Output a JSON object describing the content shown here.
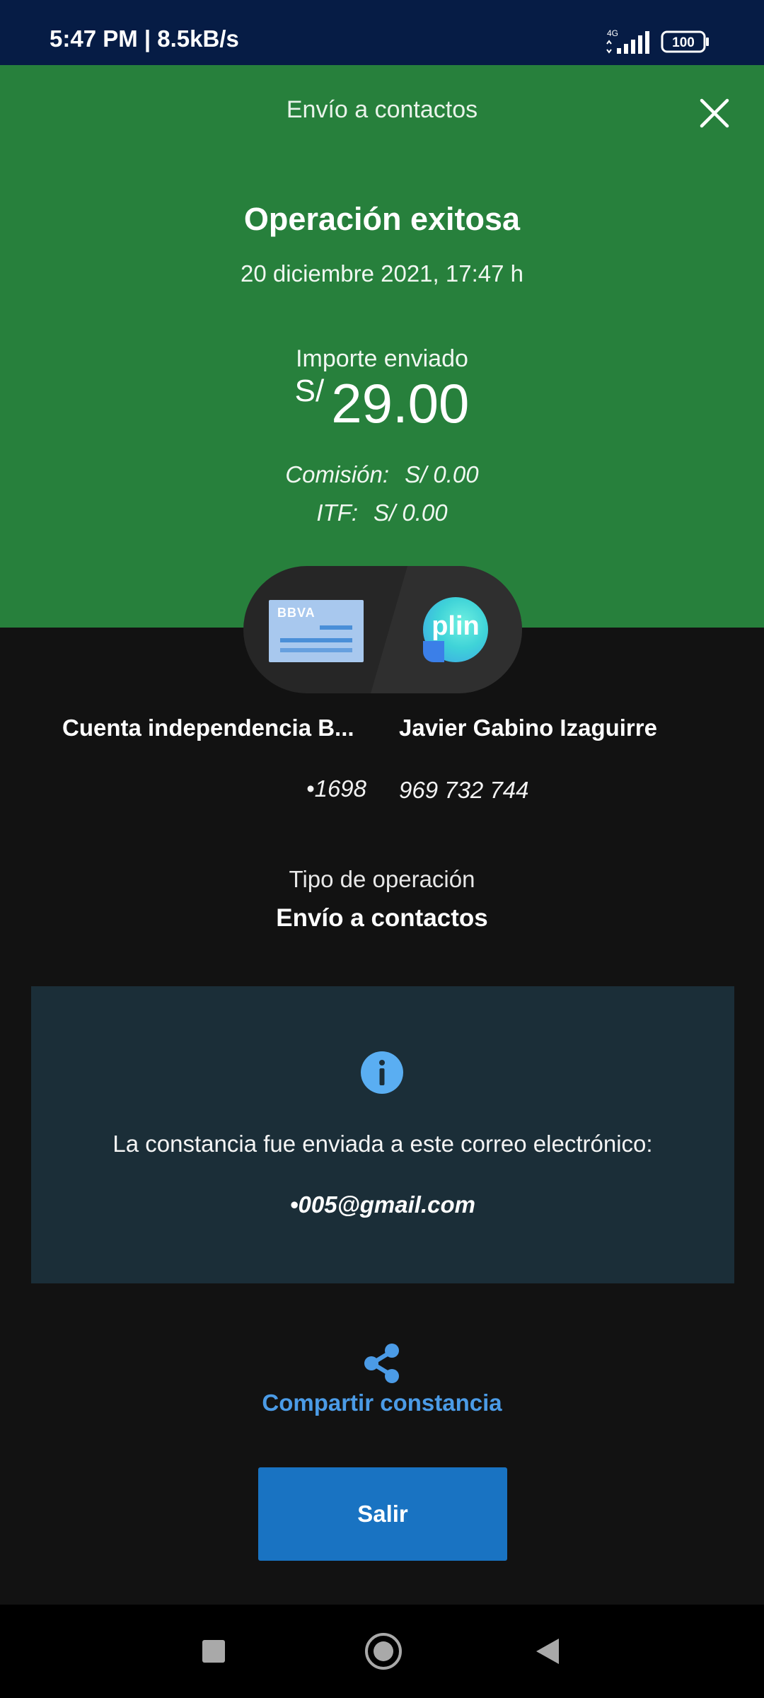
{
  "status_bar": {
    "time_speed": "5:47 PM | 8.5kB/s",
    "network": "4G",
    "battery": "100"
  },
  "header": {
    "title": "Envío a contactos",
    "close_icon": "close-icon"
  },
  "result": {
    "title": "Operación exitosa",
    "date": "20 diciembre 2021, 17:47 h",
    "amount_label": "Importe enviado",
    "currency": "S/",
    "amount": "29.00",
    "commission_label": "Comisión:",
    "commission_value": "S/ 0.00",
    "itf_label": "ITF:",
    "itf_value": "S/ 0.00"
  },
  "transfer": {
    "from_logo_text": "BBVA",
    "to_logo_text": "plin",
    "from_name": "Cuenta independencia B...",
    "from_number": "•1698",
    "to_name": "Javier Gabino Izaguirre",
    "to_number": "969 732 744"
  },
  "operation": {
    "label": "Tipo de operación",
    "value": "Envío a contactos"
  },
  "info": {
    "icon": "info-icon",
    "text": "La constancia fue enviada a este correo electrónico:",
    "email": "•005@gmail.com"
  },
  "share": {
    "icon": "share-icon",
    "label": "Compartir constancia"
  },
  "exit_button": {
    "label": "Salir"
  },
  "colors": {
    "status_bar": "#061c45",
    "hero": "#27803c",
    "background": "#121212",
    "info_box": "#1b2e38",
    "link": "#4b9be6",
    "button": "#1973c2"
  }
}
